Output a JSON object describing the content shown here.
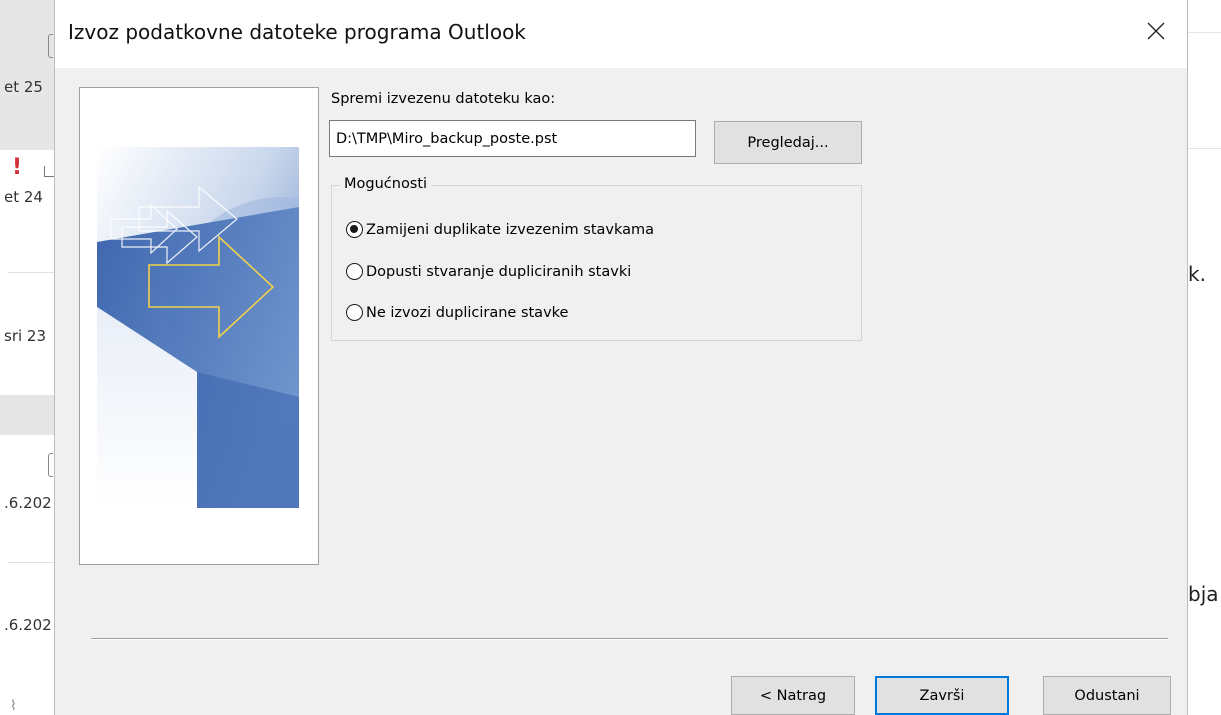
{
  "background_list": {
    "dates": [
      "et 25",
      "et 24",
      "sri 23",
      ".6.202",
      ".6.202"
    ]
  },
  "background_reading": {
    "fragments": [
      "k.",
      "bja"
    ]
  },
  "dialog": {
    "title": "Izvoz podatkovne datoteke programa Outlook",
    "save_as_label": "Spremi izvezenu datoteku kao:",
    "path_value": "D:\\TMP\\Miro_backup_poste.pst",
    "browse_label": "Pregledaj...",
    "options_legend": "Mogućnosti",
    "options": [
      {
        "label": "Zamijeni duplikate izvezenim stavkama",
        "checked": true
      },
      {
        "label": "Dopusti stvaranje dupliciranih stavki",
        "checked": false
      },
      {
        "label": "Ne izvozi duplicirane stavke",
        "checked": false
      }
    ],
    "back_label": "< Natrag",
    "finish_label": "Završi",
    "cancel_label": "Odustani"
  },
  "colors": {
    "dialog_bg": "#f0f0f0",
    "accent_focus": "#0078d7",
    "important_flag": "#d13438"
  },
  "icons": [
    "close-icon",
    "exclamation-icon",
    "envelope-icon",
    "attachment-icon"
  ]
}
